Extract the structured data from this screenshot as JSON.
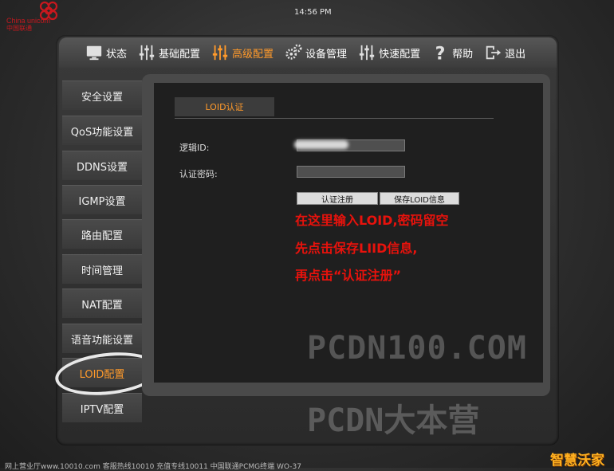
{
  "brand": {
    "name": "China unicom",
    "name_cn": "中国联通",
    "logo_icon": "china-unicom-knot-icon",
    "color": "#c8181e"
  },
  "clock": "14:56 PM",
  "nav": [
    {
      "label": "状态",
      "icon": "monitor-icon",
      "active": false
    },
    {
      "label": "基础配置",
      "icon": "sliders-icon",
      "active": false
    },
    {
      "label": "高级配置",
      "icon": "sliders-icon",
      "active": true
    },
    {
      "label": "设备管理",
      "icon": "gears-icon",
      "active": false
    },
    {
      "label": "快速配置",
      "icon": "sliders-icon",
      "active": false
    },
    {
      "label": "帮助",
      "icon": "question-icon",
      "active": false
    },
    {
      "label": "退出",
      "icon": "exit-icon",
      "active": false
    }
  ],
  "sidebar": [
    {
      "label": "安全设置"
    },
    {
      "label": "QoS功能设置"
    },
    {
      "label": "DDNS设置"
    },
    {
      "label": "IGMP设置"
    },
    {
      "label": "路由配置"
    },
    {
      "label": "时间管理"
    },
    {
      "label": "NAT配置"
    },
    {
      "label": "语音功能设置"
    },
    {
      "label": "LOID配置",
      "active": true
    },
    {
      "label": "IPTV配置"
    }
  ],
  "panel": {
    "tab": "LOID认证",
    "loid_label": "逻辑ID:",
    "password_label": "认证密码:",
    "register_button": "认证注册",
    "save_button": "保存LOID信息"
  },
  "annotation": [
    "在这里输入LOID,密码留空",
    "先点击保存LIID信息,",
    "再点击“认证注册”"
  ],
  "watermarks": [
    "PCDN100.COM",
    "PCDN大本营"
  ],
  "footer": "网上营业厅www.10010.com  客服热线10010  充值专线10011   中国联通PCMG终端 WO-37",
  "corner_logo": "智慧沃家",
  "colors": {
    "accent": "#ff9a2b",
    "annotation": "#e8120c"
  }
}
